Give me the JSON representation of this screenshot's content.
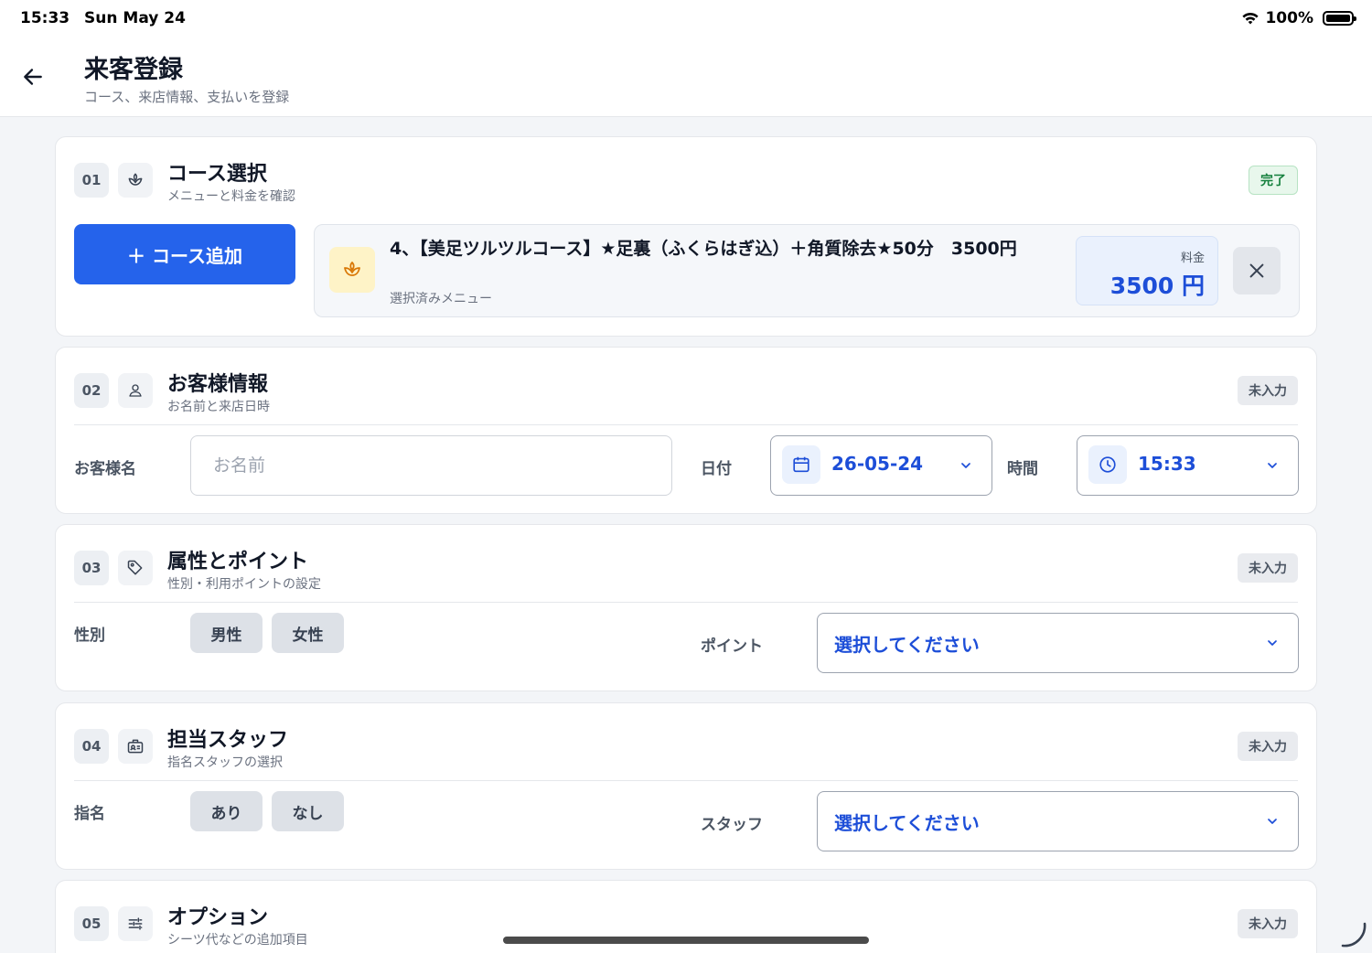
{
  "status_bar": {
    "time": "15:33",
    "date": "Sun May 24",
    "battery": "100%"
  },
  "header": {
    "title": "来客登録",
    "subtitle": "コース、来店情報、支払いを登録"
  },
  "sections": {
    "course": {
      "number": "01",
      "title": "コース選択",
      "subtitle": "メニューと料金を確認",
      "status": "完了",
      "add_button": "＋ コース追加",
      "selected_name": "4、【美足ツルツルコース】★足裏（ふくらはぎ込）＋角質除去★50分　3500円",
      "selected_sub": "選択済みメニュー",
      "price_label": "料金",
      "price_value": "3500 円"
    },
    "customer": {
      "number": "02",
      "title": "お客様情報",
      "subtitle": "お名前と来店日時",
      "status": "未入力",
      "name_label": "お客様名",
      "name_placeholder": "お名前",
      "date_label": "日付",
      "date_value": "26-05-24",
      "time_label": "時間",
      "time_value": "15:33"
    },
    "attributes": {
      "number": "03",
      "title": "属性とポイント",
      "subtitle": "性別・利用ポイントの設定",
      "status": "未入力",
      "gender_label": "性別",
      "gender_options": [
        "男性",
        "女性"
      ],
      "point_label": "ポイント",
      "point_value": "選択してください"
    },
    "staff": {
      "number": "04",
      "title": "担当スタッフ",
      "subtitle": "指名スタッフの選択",
      "status": "未入力",
      "nomination_label": "指名",
      "nomination_options": [
        "あり",
        "なし"
      ],
      "staff_label": "スタッフ",
      "staff_value": "選択してください"
    },
    "options": {
      "number": "05",
      "title": "オプション",
      "subtitle": "シーツ代などの追加項目",
      "status": "未入力"
    }
  },
  "colors": {
    "accent": "#2563eb",
    "accent_text": "#1d4ed8",
    "done": "#15803d"
  }
}
